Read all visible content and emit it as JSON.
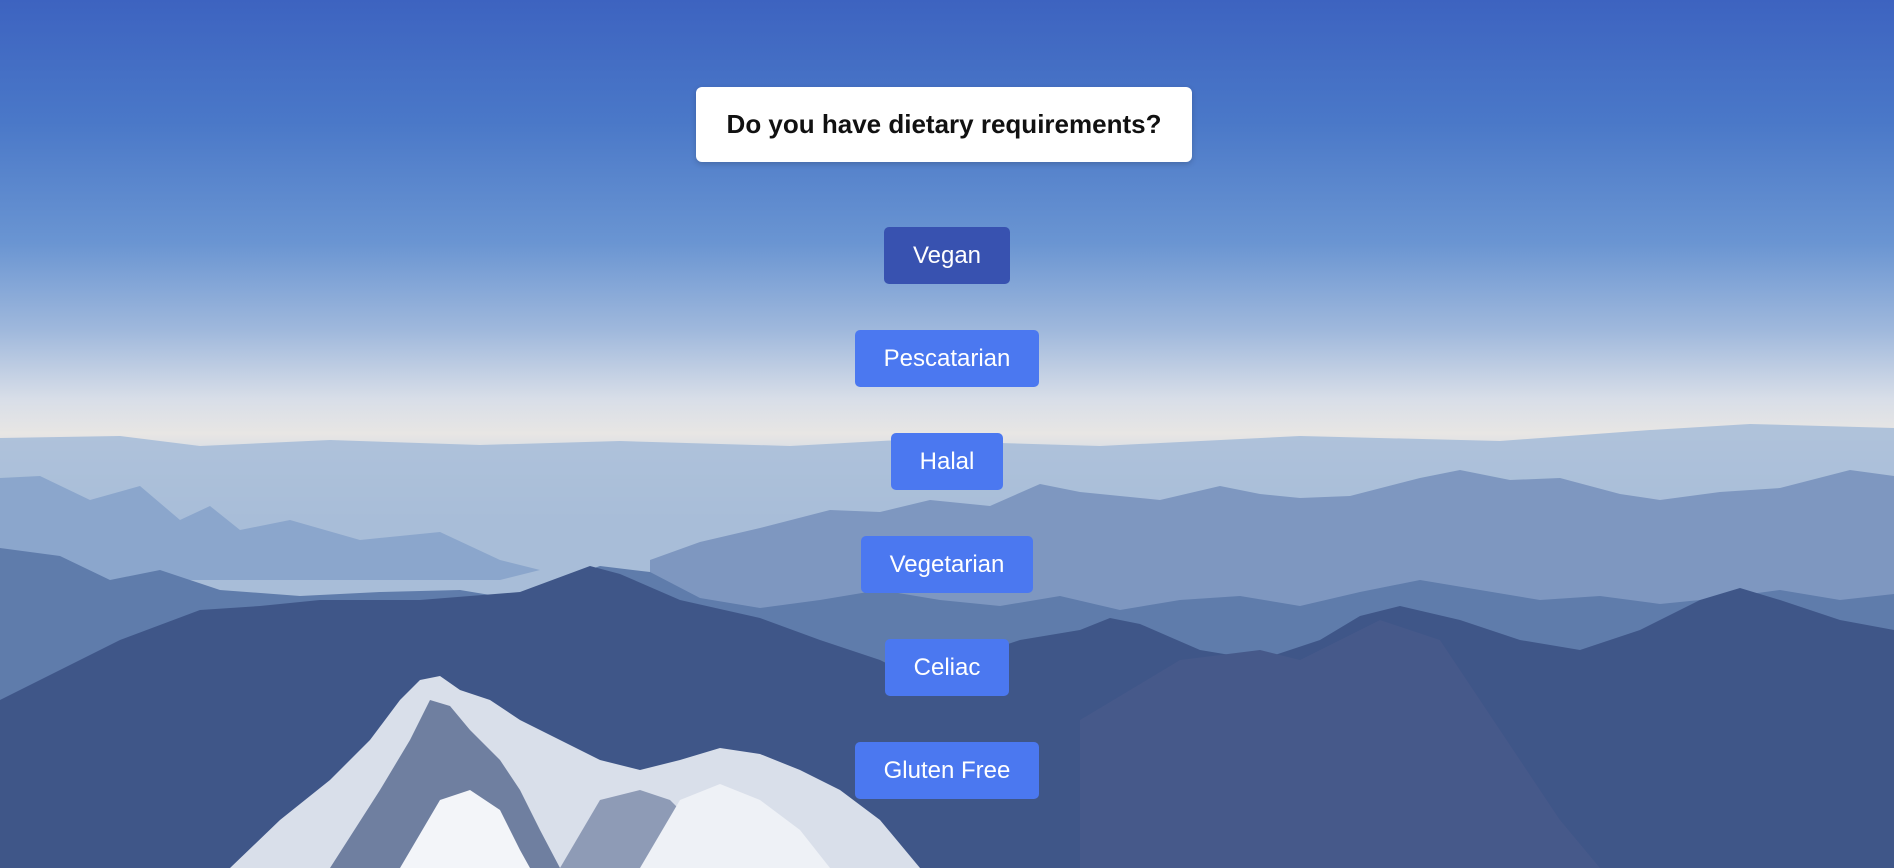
{
  "question": {
    "text": "Do you have dietary requirements?"
  },
  "options": [
    {
      "label": "Vegan",
      "selected": true
    },
    {
      "label": "Pescatarian",
      "selected": false
    },
    {
      "label": "Halal",
      "selected": false
    },
    {
      "label": "Vegetarian",
      "selected": false
    },
    {
      "label": "Celiac",
      "selected": false
    },
    {
      "label": "Gluten Free",
      "selected": false
    }
  ],
  "colors": {
    "button": "#4b78f0",
    "button_selected": "#3852b0",
    "card": "#ffffff",
    "sky_top": "#3d63c0"
  },
  "background": {
    "description_icon": "mountain-landscape"
  }
}
